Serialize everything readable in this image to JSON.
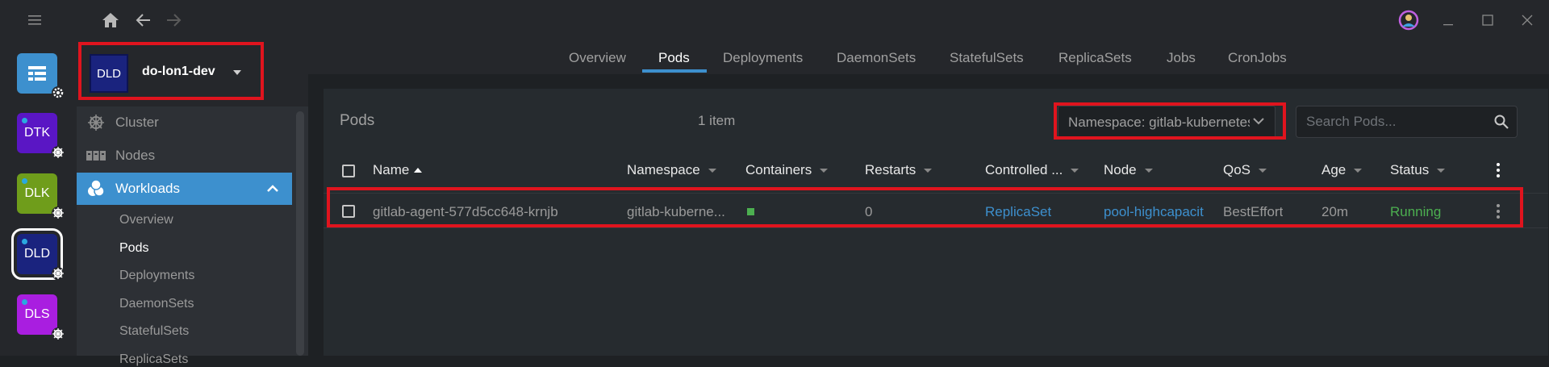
{
  "topbar": {
    "menu_icon": "hamburger-icon",
    "home_icon": "home-icon",
    "back_icon": "arrow-left-icon",
    "forward_icon": "arrow-right-icon",
    "user_icon": "user-circle-icon",
    "window": [
      "minimize-icon",
      "maximize-icon",
      "close-icon"
    ]
  },
  "hotbar": {
    "catalog_icon": "catalog-icon",
    "clusters": [
      {
        "abbr": "DTK",
        "color": "#5a16c4"
      },
      {
        "abbr": "DLK",
        "color": "#6f9d1b"
      },
      {
        "abbr": "DLD",
        "color": "#1a237e"
      },
      {
        "abbr": "DLS",
        "color": "#a91ee0"
      }
    ]
  },
  "sidebar": {
    "cluster_abbr": "DLD",
    "cluster_name": "do-lon1-dev",
    "items": [
      {
        "label": "Cluster",
        "icon": "helm-wheel-icon"
      },
      {
        "label": "Nodes",
        "icon": "nodes-icon"
      },
      {
        "label": "Workloads",
        "icon": "workloads-icon"
      }
    ],
    "workloads_sub": [
      "Overview",
      "Pods",
      "Deployments",
      "DaemonSets",
      "StatefulSets",
      "ReplicaSets"
    ]
  },
  "tabs": [
    "Overview",
    "Pods",
    "Deployments",
    "DaemonSets",
    "StatefulSets",
    "ReplicaSets",
    "Jobs",
    "CronJobs"
  ],
  "active_tab": "Pods",
  "panel": {
    "title": "Pods",
    "count": "1 item",
    "namespace_select": "Namespace: gitlab-kubernetes",
    "search_placeholder": "Search Pods..."
  },
  "table": {
    "columns": [
      "Name",
      "Namespace",
      "Containers",
      "Restarts",
      "Controlled ...",
      "Node",
      "QoS",
      "Age",
      "Status"
    ],
    "rows": [
      {
        "name": "gitlab-agent-577d5cc648-krnjb",
        "namespace": "gitlab-kuberne...",
        "containers_status": "running",
        "restarts": "0",
        "controlled_by": "ReplicaSet",
        "node": "pool-highcapacit",
        "qos": "BestEffort",
        "age": "20m",
        "status": "Running"
      }
    ]
  },
  "colors": {
    "accent": "#3d90ce",
    "link": "#3d90ce",
    "running": "#4caf50",
    "highlight": "#e0141e"
  }
}
